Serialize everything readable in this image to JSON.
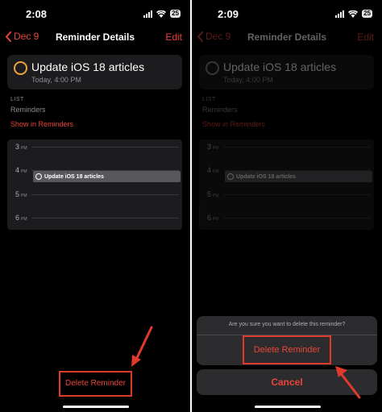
{
  "left": {
    "time": "2:08",
    "battery": "25",
    "nav": {
      "back": "Dec 9",
      "title": "Reminder Details",
      "edit": "Edit"
    },
    "reminder": {
      "title": "Update iOS 18 articles",
      "subtitle": "Today, 4:00 PM"
    },
    "list": {
      "label": "LIST",
      "value": "Reminders",
      "link": "Show in Reminders"
    },
    "calendar": {
      "hours": [
        {
          "num": "3",
          "ampm": "PM"
        },
        {
          "num": "4",
          "ampm": "PM"
        },
        {
          "num": "5",
          "ampm": "PM"
        },
        {
          "num": "6",
          "ampm": "PM"
        }
      ],
      "event": "Update iOS 18 articles"
    },
    "delete_button": "Delete Reminder"
  },
  "right": {
    "time": "2:09",
    "battery": "25",
    "nav": {
      "back": "Dec 9",
      "title": "Reminder Details",
      "edit": "Edit"
    },
    "reminder": {
      "title": "Update iOS 18 articles",
      "subtitle": "Today, 4:00 PM"
    },
    "list": {
      "label": "LIST",
      "value": "Reminders",
      "link": "Show in Reminders"
    },
    "calendar": {
      "hours": [
        {
          "num": "3",
          "ampm": "PM"
        },
        {
          "num": "4",
          "ampm": "PM"
        },
        {
          "num": "5",
          "ampm": "PM"
        },
        {
          "num": "6",
          "ampm": "PM"
        }
      ],
      "event": "Update iOS 18 articles"
    },
    "sheet": {
      "message": "Are you sure you want to delete this reminder?",
      "confirm": "Delete Reminder",
      "cancel": "Cancel"
    }
  },
  "colors": {
    "accent": "#e9453b",
    "highlight_box": "#e03a2c",
    "circle": "#f0a23b",
    "background": "#000000",
    "card": "#1c1c1e"
  },
  "icons": [
    "chevron-left-icon",
    "signal-icon",
    "wifi-icon",
    "battery-icon",
    "reminder-circle-icon",
    "arrow-icon"
  ]
}
